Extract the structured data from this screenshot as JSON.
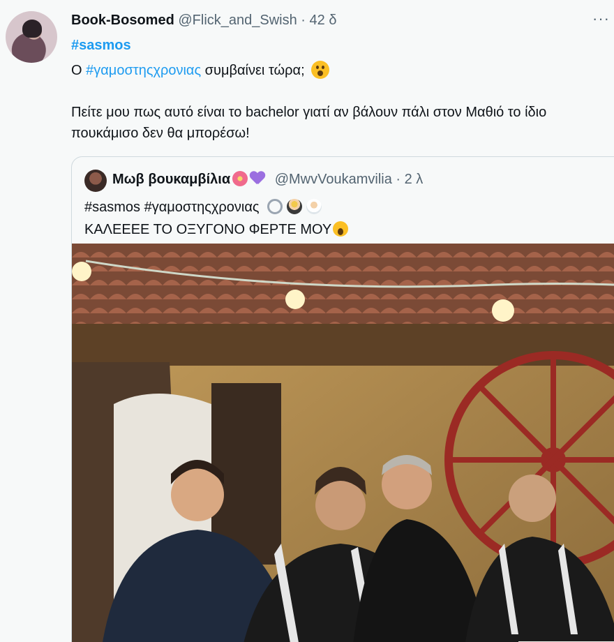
{
  "tweet": {
    "author_name": "Book-Bosomed",
    "author_handle": "@Flick_and_Swish",
    "separator": "·",
    "time": "42 δ",
    "more": "···",
    "hashtag": "#sasmos",
    "line2_prefix": "Ο ",
    "line2_link": "#γαμοστηςχρονιας",
    "line2_suffix": " συμβαίνει τώρα;",
    "paragraph": "Πείτε μου πως αυτό είναι το bachelor γιατί αν βάλουν πάλι στον Μαθιό το ίδιο πουκάμισο δεν θα μπορέσω!"
  },
  "quote": {
    "author_name": "Μωβ βουκαμβίλια",
    "author_handle": "@MwvVoukamvilia",
    "separator": "·",
    "time": "2 λ",
    "hashtags": "#sasmos #γαμοστηςχρονιας",
    "text": "ΚΑΛΕΕΕΕ ΤΟ ΟΞΥΓΟΝΟ ΦΕΡΤΕ ΜΟΥ"
  },
  "colors": {
    "link": "#1d9bf0",
    "muted": "#536471",
    "border": "#cfd9de",
    "background": "#f7f9f9"
  },
  "icons": [
    "more-icon",
    "astonished-face-icon",
    "hibiscus-icon",
    "purple-heart-icon",
    "ring-icon",
    "groom-icon",
    "bride-icon",
    "screaming-face-icon"
  ]
}
